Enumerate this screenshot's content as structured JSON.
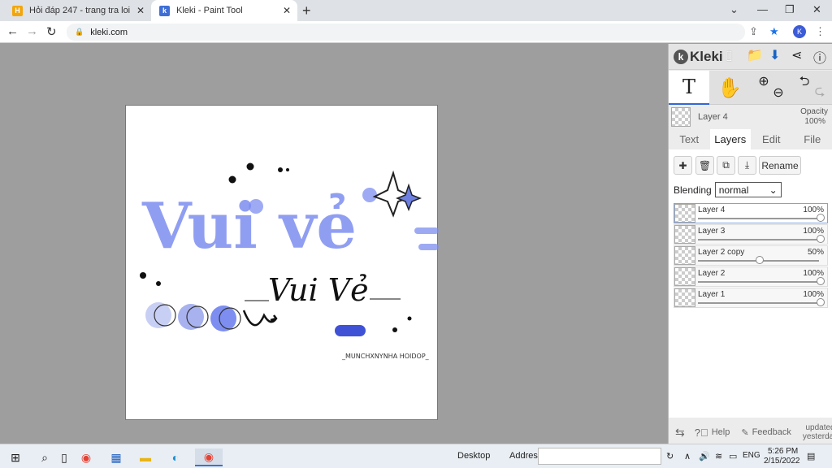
{
  "browser": {
    "tabs": [
      {
        "title": "Hỏi đáp 247 - trang tra loi",
        "active": false
      },
      {
        "title": "Kleki - Paint Tool",
        "active": true
      }
    ],
    "url": "kleki.com"
  },
  "kleki": {
    "logo": "Kleki",
    "current_layer": {
      "name": "Layer 4",
      "opacity_label": "Opacity",
      "opacity_value": "100%"
    },
    "panel_tabs": [
      "Text",
      "Layers",
      "Edit",
      "File"
    ],
    "active_panel_tab": "Layers",
    "rename_label": "Rename",
    "blending_label": "Blending",
    "blending_value": "normal",
    "layers": [
      {
        "name": "Layer 4",
        "opacity": "100%",
        "level": 1.0,
        "selected": true
      },
      {
        "name": "Layer 3",
        "opacity": "100%",
        "level": 1.0,
        "selected": false
      },
      {
        "name": "Layer 2 copy",
        "opacity": "50%",
        "level": 0.5,
        "selected": false
      },
      {
        "name": "Layer 2",
        "opacity": "100%",
        "level": 1.0,
        "selected": false
      },
      {
        "name": "Layer 1",
        "opacity": "100%",
        "level": 1.0,
        "selected": false
      }
    ],
    "footer": {
      "help": "Help",
      "feedback": "Feedback",
      "updated_line1": "updated",
      "updated_line2": "yesterday"
    }
  },
  "artwork": {
    "main_text": "Vui vẻ",
    "script_text": "Vui Vẻ",
    "signature": "_MUNCHXNYNHA HOIDOP_"
  },
  "taskbar": {
    "desktop_label": "Desktop",
    "address_label": "Address",
    "language": "ENG",
    "time": "5:26 PM",
    "date": "2/15/2022"
  },
  "colors": {
    "accent": "#6d7fe0",
    "chrome_tab_bar": "#dee1e6",
    "work_bg": "#9e9e9e"
  }
}
